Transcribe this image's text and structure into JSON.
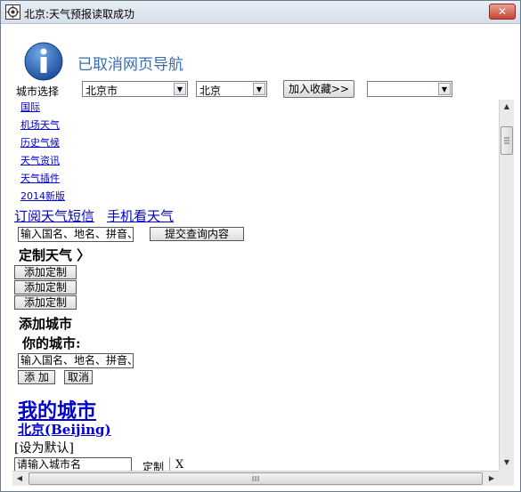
{
  "window": {
    "title": "北京:天气预报读取成功",
    "close_symbol": "✕"
  },
  "header": {
    "title": "已取消网页导航"
  },
  "city_row": {
    "label": "城市选择",
    "province_value": "北京市",
    "city_value": "北京",
    "favorite_button": "加入收藏>>",
    "favorite_value": ""
  },
  "content": {
    "small_links": [
      "国际",
      "机场天气",
      "历史气候",
      "天气资讯",
      "天气插件",
      "2014新版"
    ],
    "sms_link": "订阅天气短信",
    "mobile_link": "手机看天气",
    "search_input_value": "输入国名、地名、拼音、",
    "submit_button": "提交查询内容",
    "custom_weather_heading": "定制天气 〉",
    "add_custom_buttons": [
      "添加定制",
      "添加定制",
      "添加定制"
    ],
    "add_city_heading": "添加城市",
    "your_city_label": "你的城市:",
    "city_input_value": "输入国名、地名、拼音、",
    "add_button": "添 加",
    "cancel_button": "取消",
    "my_cities_heading": "我的城市",
    "city_link": "北京(Beijing)",
    "set_default": "[设为默认]",
    "bottom_input_value": "请输入城市名",
    "customize_label": "定制",
    "close_x": "X"
  },
  "icons": {
    "app": "gear-icon",
    "info": "info-icon",
    "accent": "#3a6cb0",
    "link": "#0000cc"
  }
}
